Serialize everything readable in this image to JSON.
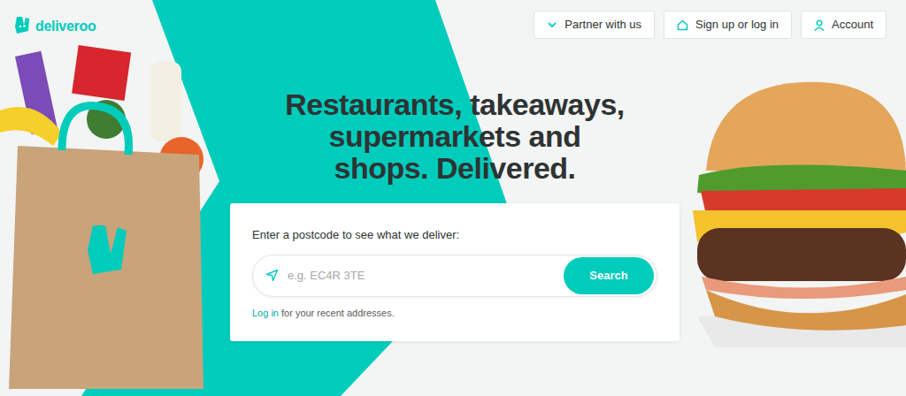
{
  "logo": {
    "text": "deliveroo"
  },
  "nav": [
    {
      "label": "Partner with us"
    },
    {
      "label": "Sign up or log in"
    },
    {
      "label": "Account"
    }
  ],
  "hero": {
    "headline_lines": [
      "Restaurants, takeaways,",
      "supermarkets and",
      "shops. Delivered."
    ]
  },
  "search": {
    "label": "Enter a postcode to see what we deliver:",
    "placeholder": "e.g. EC4R 3TE",
    "button": "Search"
  },
  "login_hint": {
    "link": "Log in",
    "text": "for your recent addresses."
  }
}
